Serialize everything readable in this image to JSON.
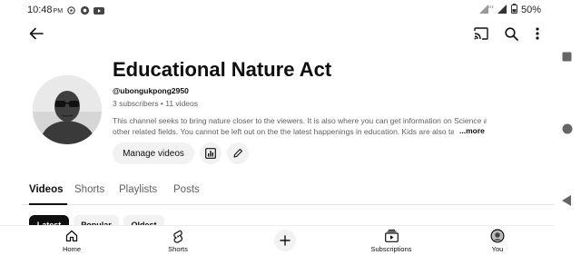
{
  "status_bar": {
    "time": "10:48",
    "ampm": "PM",
    "network": "LTE",
    "battery": "50%"
  },
  "top_bar": {
    "icons": [
      "back-arrow-icon",
      "cast-icon",
      "search-icon",
      "more-vert-icon"
    ]
  },
  "channel": {
    "title": "Educational Nature Act",
    "handle": "@ubongukpong2950",
    "meta": "3 subscribers • 11 videos",
    "description_line1": "This channel seeks to bring nature closer to the viewers. It is also where you can get information on Science and",
    "description_line2": "other related fields. You cannot be left out on the the latest happenings in education. Kids are also taken",
    "more_label": "...more",
    "manage_label": "Manage videos"
  },
  "tabs": [
    {
      "label": "Videos",
      "active": true
    },
    {
      "label": "Shorts",
      "active": false
    },
    {
      "label": "Playlists",
      "active": false
    },
    {
      "label": "Posts",
      "active": false
    }
  ],
  "chips": [
    {
      "label": "Latest",
      "selected": true
    },
    {
      "label": "Popular",
      "selected": false
    },
    {
      "label": "Oldest",
      "selected": false
    }
  ],
  "bottom_nav": [
    {
      "label": "Home",
      "icon": "home-icon"
    },
    {
      "label": "Shorts",
      "icon": "shorts-icon"
    },
    {
      "label": "",
      "icon": "create-plus-icon"
    },
    {
      "label": "Subscriptions",
      "icon": "subscriptions-icon"
    },
    {
      "label": "You",
      "icon": "avatar-icon"
    }
  ]
}
